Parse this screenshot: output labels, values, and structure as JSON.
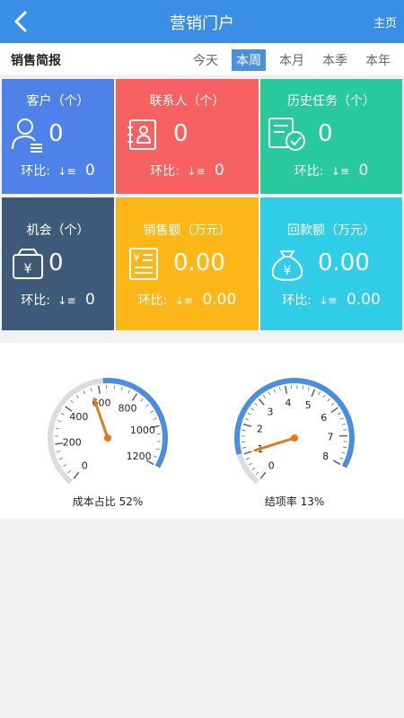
{
  "header": {
    "title": "营销门户",
    "home_label": "主页"
  },
  "subbar": {
    "title": "销售简报",
    "tabs": [
      {
        "label": "今天",
        "active": false
      },
      {
        "label": "本周",
        "active": true
      },
      {
        "label": "本月",
        "active": false
      },
      {
        "label": "本季",
        "active": false
      },
      {
        "label": "本年",
        "active": false
      }
    ]
  },
  "cards": [
    {
      "label": "客户（个）",
      "value": "0",
      "compare_label": "环比:",
      "compare_icon": "↓≡",
      "compare_value": "0",
      "color": "#4f82e8",
      "icon": "customer-icon"
    },
    {
      "label": "联系人（个）",
      "value": "0",
      "compare_label": "环比:",
      "compare_icon": "↓≡",
      "compare_value": "0",
      "color": "#f76161",
      "icon": "contacts-icon"
    },
    {
      "label": "历史任务（个）",
      "value": "0",
      "compare_label": "环比:",
      "compare_icon": "↓≡",
      "compare_value": "0",
      "color": "#28c99a",
      "icon": "task-icon"
    },
    {
      "label": "机会（个）",
      "value": "0",
      "compare_label": "环比:",
      "compare_icon": "↓≡",
      "compare_value": "0",
      "color": "#3d5a78",
      "icon": "opportunity-icon"
    },
    {
      "label": "销售额（万元）",
      "value": "0.00",
      "compare_label": "环比:",
      "compare_icon": "↓≡",
      "compare_value": "0.00",
      "color": "#fbb718",
      "icon": "sales-icon"
    },
    {
      "label": "回款额（万元）",
      "value": "0.00",
      "compare_label": "环比:",
      "compare_icon": "↓≡",
      "compare_value": "0.00",
      "color": "#2fcde8",
      "icon": "money-bag-icon"
    }
  ],
  "gauges": [
    {
      "label": "成本占比 52%",
      "min": 0,
      "max": 1400,
      "ticks": [
        "0",
        "200",
        "400",
        "600",
        "800",
        "1000",
        "1200"
      ],
      "value": 650,
      "percent": 52,
      "needle_color": "#e07a1c",
      "arc_color": "#4a8ee0"
    },
    {
      "label": "结项率 13%",
      "min": 0,
      "max": 8,
      "ticks": [
        "0",
        "1",
        "2",
        "3",
        "4",
        "5",
        "6",
        "7",
        "8"
      ],
      "value": 1,
      "percent": 13,
      "needle_color": "#e07a1c",
      "arc_color": "#4a8ee0"
    }
  ]
}
